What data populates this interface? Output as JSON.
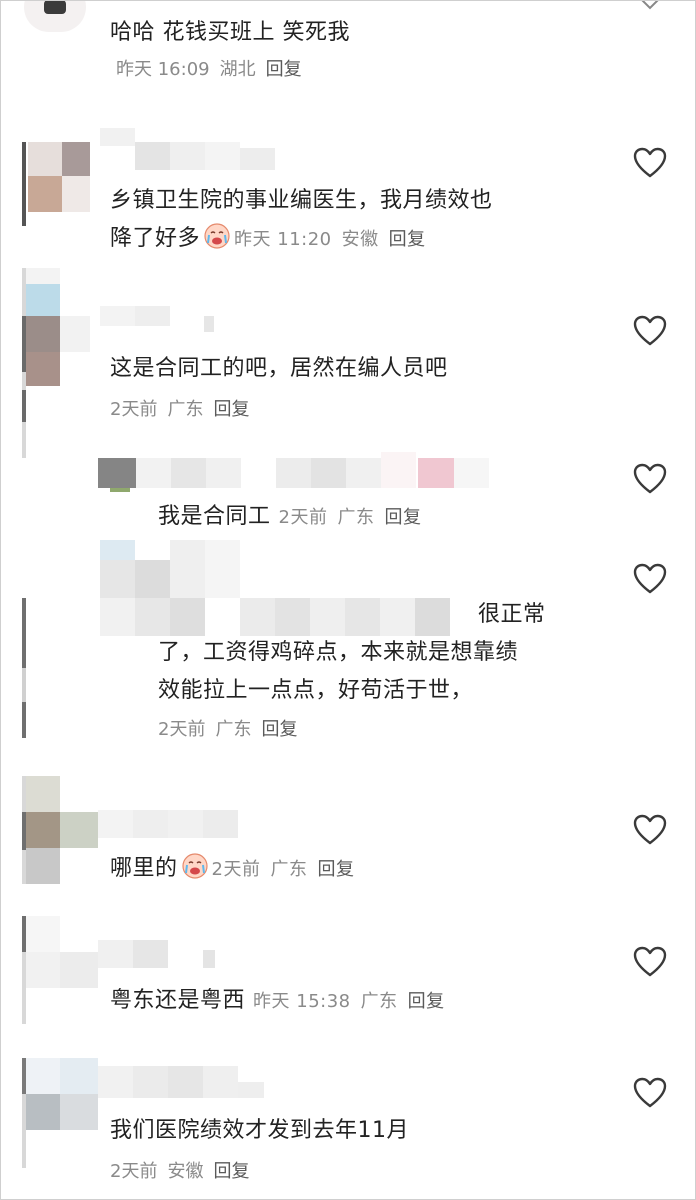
{
  "comments": [
    {
      "text": "哈哈 花钱买班上 笑死我",
      "time": "昨天 16:09",
      "location": "湖北",
      "reply": "回复"
    },
    {
      "text_line1": "乡镇卫生院的事业编医生，我月绩效也",
      "text_line2": "降了好多",
      "time": "昨天 11:20",
      "location": "安徽",
      "reply": "回复"
    },
    {
      "text": "这是合同工的吧，居然在编人员吧",
      "time": "2天前",
      "location": "广东",
      "reply": "回复"
    },
    {
      "text": "我是合同工",
      "time": "2天前",
      "location": "广东",
      "reply": "回复"
    },
    {
      "text_line1": "很正常",
      "text_line2": "了，工资得鸡碎点，本来就是想靠绩",
      "text_line3": "效能拉上一点点，好苟活于世，",
      "time": "2天前",
      "location": "广东",
      "reply": "回复"
    },
    {
      "text": "哪里的",
      "time": "2天前",
      "location": "广东",
      "reply": "回复"
    },
    {
      "text": "粤东还是粤西",
      "time": "昨天 15:38",
      "location": "广东",
      "reply": "回复"
    },
    {
      "text": "我们医院绩效才发到去年11月",
      "time": "2天前",
      "location": "安徽",
      "reply": "回复"
    }
  ],
  "icons": {
    "like": "heart-outline-icon",
    "emoji": "crying-face-emoji-icon",
    "more": "chevron-down-icon"
  },
  "colors": {
    "text": "#222222",
    "meta": "#8a8a8a",
    "reply": "#5a5a5a",
    "heart": "#3a3a3a"
  }
}
